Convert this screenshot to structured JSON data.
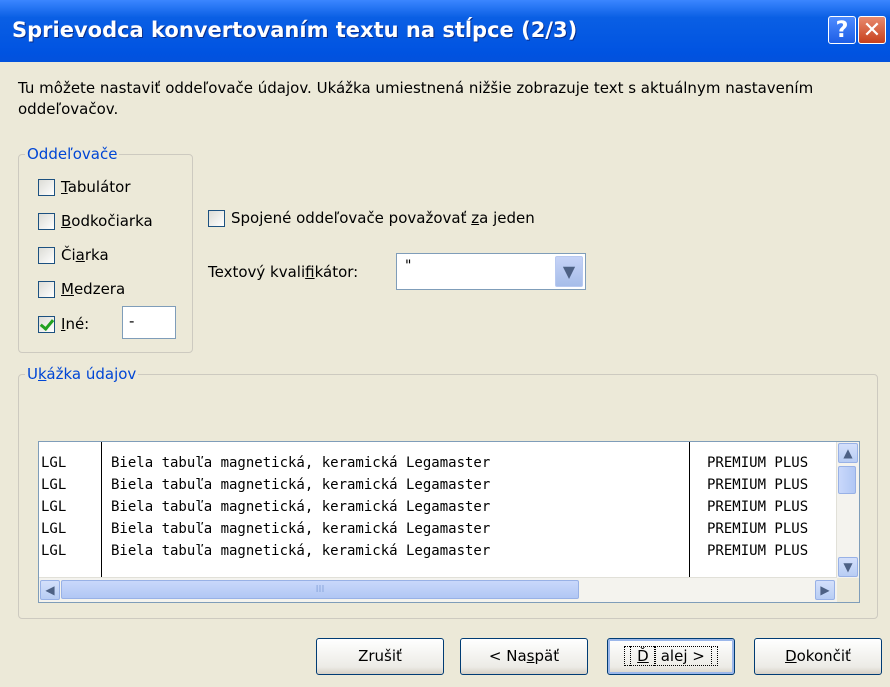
{
  "window": {
    "title": "Sprievodca konvertovaním textu na stĺpce (2/3)",
    "help_label": "?",
    "close_label": "✕"
  },
  "intro_text": "Tu môžete nastaviť oddeľovače údajov. Ukážka umiestnená nižšie zobrazuje text s aktuálnym nastavením oddeľovačov.",
  "delimiters": {
    "legend": "Oddeľovače",
    "items": [
      {
        "pre": "",
        "u": "T",
        "post": "abulátor",
        "checked": false
      },
      {
        "pre": "",
        "u": "B",
        "post": "odkočiarka",
        "checked": false
      },
      {
        "pre": "Či",
        "u": "a",
        "post": "rka",
        "checked": false
      },
      {
        "pre": "",
        "u": "M",
        "post": "edzera",
        "checked": false
      },
      {
        "pre": "",
        "u": "I",
        "post": "né:",
        "checked": true
      }
    ],
    "other_value": "-"
  },
  "consecutive": {
    "pre": "Spojené oddeľovače považovať ",
    "u": "z",
    "post": "a jeden",
    "checked": false
  },
  "qualifier": {
    "pre": "Textový kvali",
    "u": "f",
    "post": "ikátor:",
    "value": "\""
  },
  "preview": {
    "legend_pre": "U",
    "legend_u": "k",
    "legend_post": "ážka údajov",
    "rows": [
      [
        "LGL",
        "Biela tabuľa magnetická, keramická Legamaster",
        "PREMIUM PLUS"
      ],
      [
        "LGL",
        "Biela tabuľa magnetická, keramická Legamaster",
        "PREMIUM PLUS"
      ],
      [
        "LGL",
        "Biela tabuľa magnetická, keramická Legamaster",
        "PREMIUM PLUS"
      ],
      [
        "LGL",
        "Biela tabuľa magnetická, keramická Legamaster",
        "PREMIUM PLUS"
      ],
      [
        "LGL",
        "Biela tabuľa magnetická, keramická Legamaster",
        "PREMIUM PLUS"
      ]
    ],
    "hscroll_grip": "III"
  },
  "buttons": {
    "cancel": "Zrušiť",
    "back": {
      "pre": "< Na",
      "u": "s",
      "post": "päť"
    },
    "next": {
      "pre": "",
      "u": "Ď",
      "post": "alej >"
    },
    "finish": {
      "pre": "",
      "u": "D",
      "post": "okončiť"
    }
  },
  "colors": {
    "title_blue": "#0053e1",
    "legend_blue": "#0046d5",
    "face": "#ece9d8"
  }
}
